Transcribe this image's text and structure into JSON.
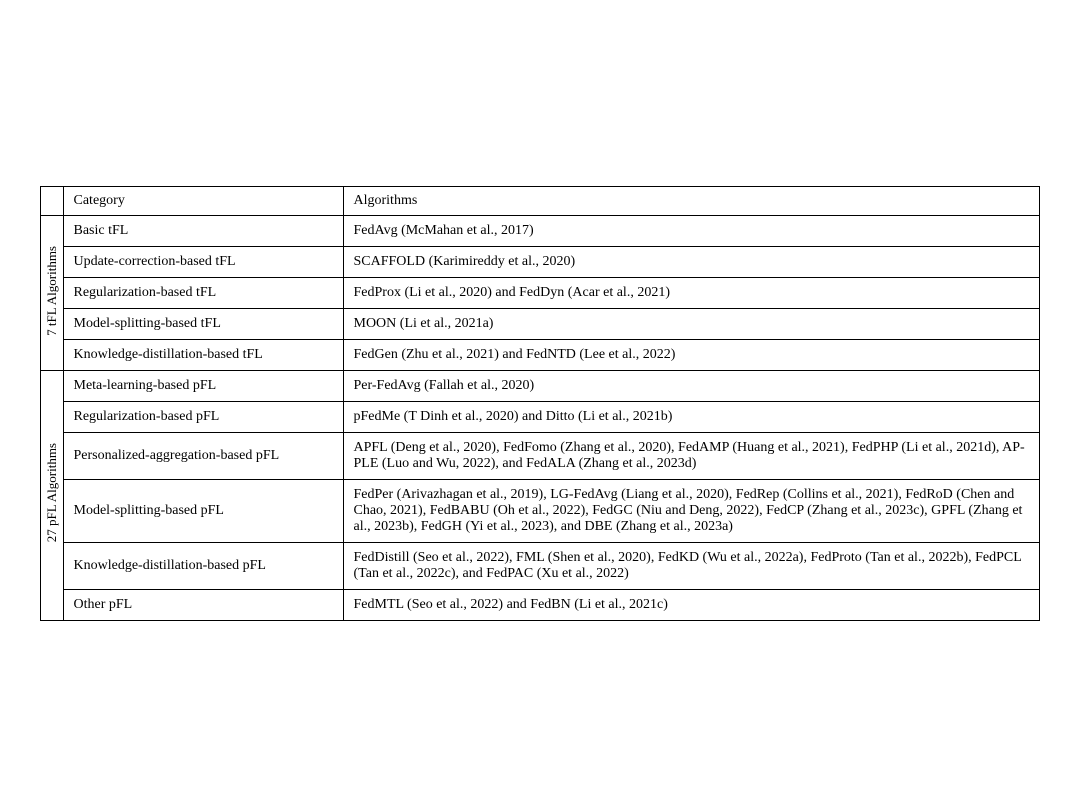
{
  "header": {
    "col1": "",
    "col2": "Category",
    "col3": "Algorithms"
  },
  "tfl_label": "7 tFL Algorithms",
  "pfl_label": "27 pFL Algorithms",
  "tfl_rows": [
    {
      "category": "Basic tFL",
      "algorithms": "FedAvg (McMahan et al., 2017)"
    },
    {
      "category": "Update-correction-based tFL",
      "algorithms": "SCAFFOLD (Karimireddy et al., 2020)"
    },
    {
      "category": "Regularization-based tFL",
      "algorithms": "FedProx (Li et al., 2020) and FedDyn (Acar et al., 2021)"
    },
    {
      "category": "Model-splitting-based tFL",
      "algorithms": "MOON (Li et al., 2021a)"
    },
    {
      "category": "Knowledge-distillation-based tFL",
      "algorithms": "FedGen (Zhu et al., 2021) and FedNTD (Lee et al., 2022)"
    }
  ],
  "pfl_rows": [
    {
      "category": "Meta-learning-based pFL",
      "algorithms": "Per-FedAvg (Fallah et al., 2020)"
    },
    {
      "category": "Regularization-based pFL",
      "algorithms": "pFedMe (T Dinh et al., 2020) and Ditto (Li et al., 2021b)"
    },
    {
      "category": "Personalized-aggregation-based pFL",
      "algorithms": "APFL (Deng et al., 2020), FedFomo (Zhang et al., 2020), FedAMP (Huang et al., 2021), FedPHP (Li et al., 2021d), AP-PLE (Luo and Wu, 2022), and FedALA (Zhang et al., 2023d)"
    },
    {
      "category": "Model-splitting-based pFL",
      "algorithms": "FedPer (Arivazhagan et al., 2019), LG-FedAvg (Liang et al., 2020), FedRep (Collins et al., 2021), FedRoD (Chen and Chao, 2021), FedBABU (Oh et al., 2022), FedGC (Niu and Deng, 2022), FedCP (Zhang et al., 2023c), GPFL (Zhang et al., 2023b), FedGH (Yi et al., 2023), and DBE (Zhang et al., 2023a)"
    },
    {
      "category": "Knowledge-distillation-based pFL",
      "algorithms": "FedDistill (Seo et al., 2022), FML (Shen et al., 2020), FedKD (Wu et al., 2022a), FedProto (Tan et al., 2022b), FedPCL (Tan et al., 2022c), and FedPAC (Xu et al., 2022)"
    },
    {
      "category": "Other pFL",
      "algorithms": "FedMTL (Seo et al., 2022) and FedBN (Li et al., 2021c)"
    }
  ]
}
